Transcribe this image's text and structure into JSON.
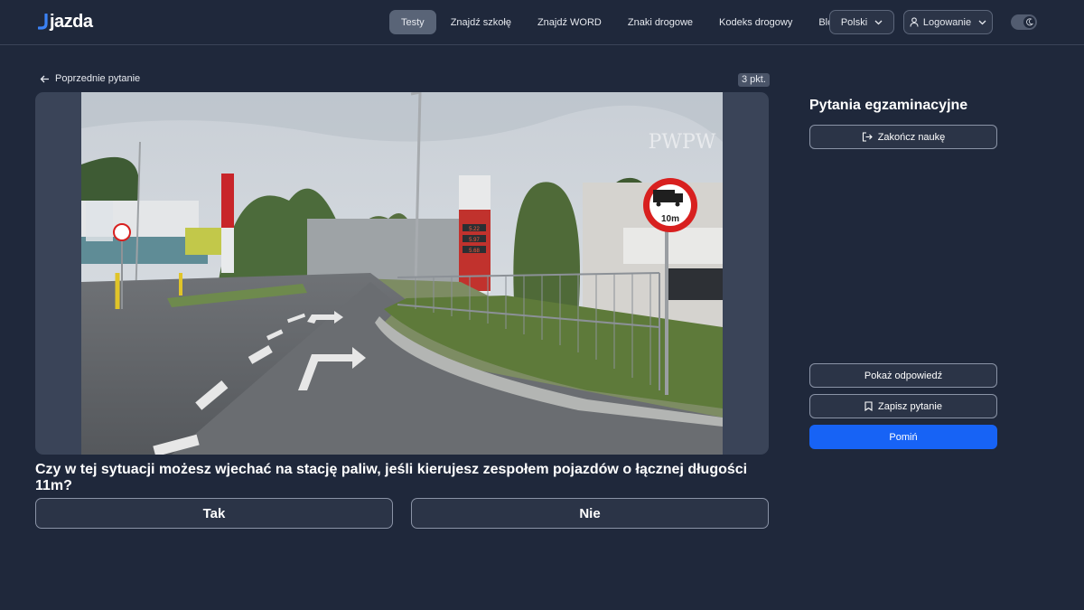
{
  "brand": {
    "name": "jazda"
  },
  "nav": {
    "items": [
      {
        "label": "Testy",
        "active": true
      },
      {
        "label": "Znajdź szkołę"
      },
      {
        "label": "Znajdź WORD"
      },
      {
        "label": "Znaki drogowe"
      },
      {
        "label": "Kodeks drogowy"
      },
      {
        "label": "Blog"
      }
    ],
    "language": "Polski",
    "login": "Logowanie"
  },
  "question_view": {
    "prev_label": "Poprzednie pytanie",
    "points": "3 pkt.",
    "image": {
      "sign_text": "10m",
      "watermark": "PWPW",
      "fuel_prices": [
        "5.22",
        "5.97",
        "5.68"
      ]
    },
    "question": "Czy w tej sytuacji możesz wjechać na stację paliw, jeśli kierujesz zespołem pojazdów o łącznej długości 11m?",
    "answers": [
      "Tak",
      "Nie"
    ]
  },
  "sidebar": {
    "title": "Pytania egzaminacyjne",
    "finish_label": "Zakończ naukę",
    "show_answer_label": "Pokaż odpowiedź",
    "save_label": "Zapisz pytanie",
    "skip_label": "Pomiń"
  },
  "colors": {
    "background": "#1f283b",
    "primary": "#1763f5",
    "sign_red": "#d8201f"
  }
}
